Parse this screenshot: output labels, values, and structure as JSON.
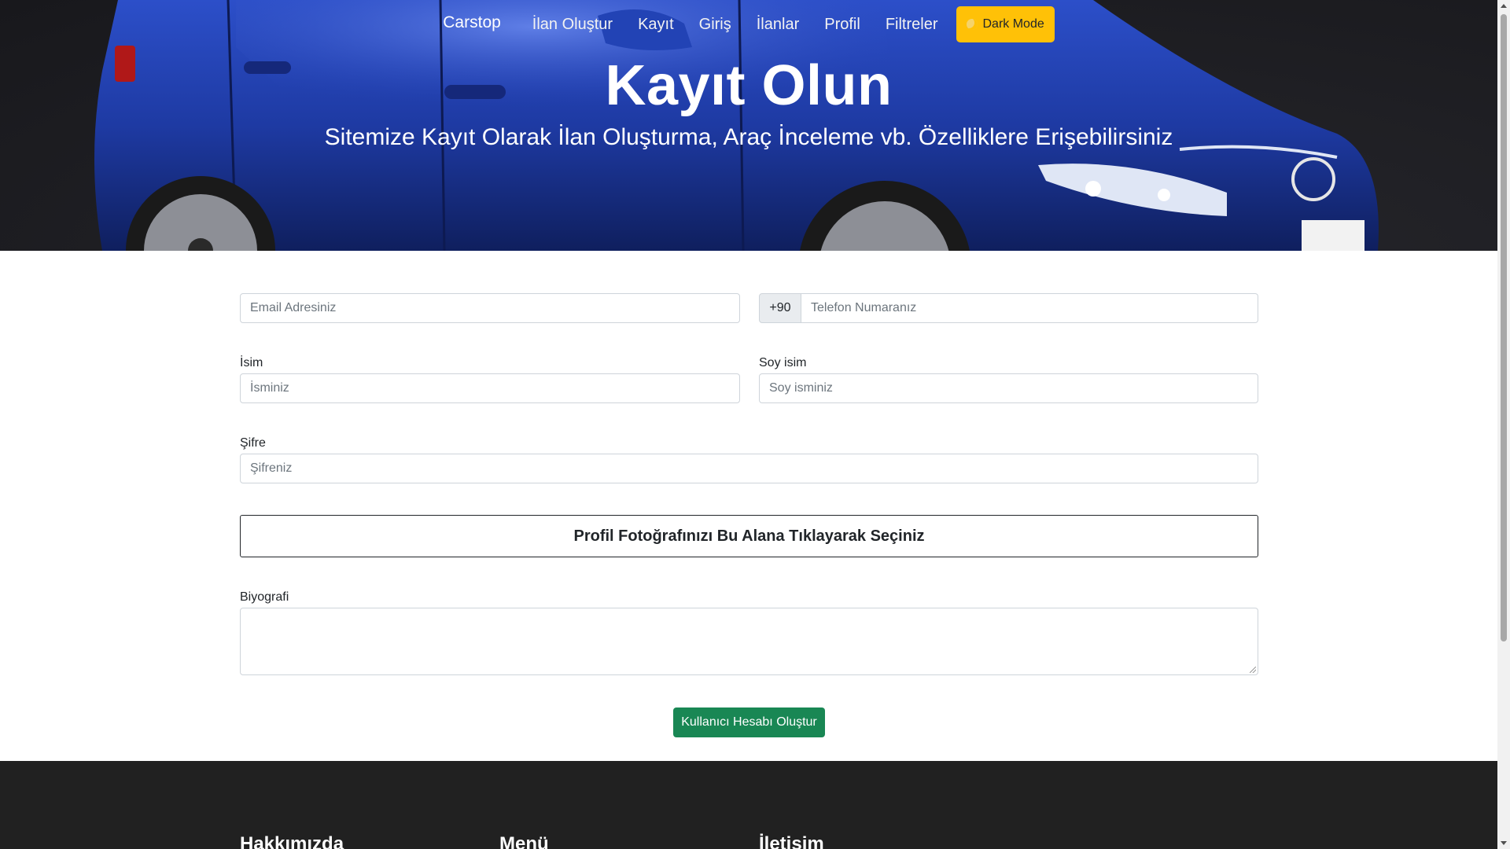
{
  "nav": {
    "brand": "Carstop",
    "links": [
      "İlan Oluştur",
      "Kayıt",
      "Giriş",
      "İlanlar",
      "Profil",
      "Filtreler"
    ],
    "dark_mode_label": "Dark Mode"
  },
  "hero": {
    "title": "Kayıt Olun",
    "subtitle": "Sitemize Kayıt Olarak İlan Oluşturma, Araç İnceleme vb. Özelliklere Erişebilirsiniz"
  },
  "form": {
    "email_placeholder": "Email Adresiniz",
    "phone_prefix": "+90",
    "phone_placeholder": "Telefon Numaranız",
    "first_name_label": "İsim",
    "first_name_placeholder": "İsminiz",
    "last_name_label": "Soy isim",
    "last_name_placeholder": "Soy isminiz",
    "password_label": "Şifre",
    "password_placeholder": "Şifreniz",
    "photo_label": "Profil Fotoğrafınızı Bu Alana Tıklayarak Seçiniz",
    "bio_label": "Biyografi",
    "bio_value": "",
    "submit_label": "Kullanıcı Hesabı Oluştur"
  },
  "footer": {
    "about_heading": "Hakkımızda",
    "menu_heading": "Menü",
    "contact_heading": "İletişim"
  },
  "colors": {
    "accent_yellow": "#ffc107",
    "submit_green": "#198754",
    "footer_bg": "#212121",
    "car_blue": "#1f3fa8"
  }
}
